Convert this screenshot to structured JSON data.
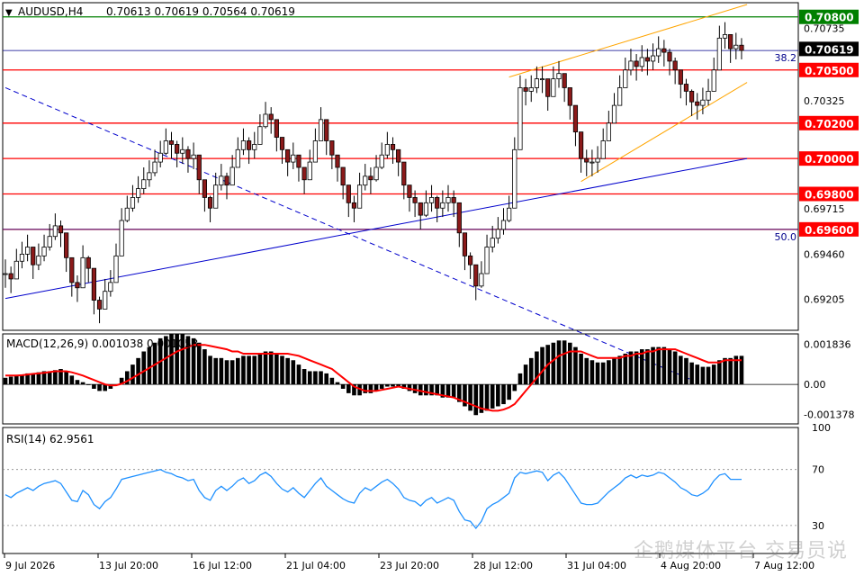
{
  "header": {
    "symbol_tf": "AUDUSD,H4",
    "ohlc": "0.70613 0.70619 0.70564 0.70619"
  },
  "watermark": "企鹅媒体平台 交易员说",
  "colors": {
    "bull": "#ff0000",
    "candle_body_up": "#ffffff",
    "candle_body_down": "#8b1a1a",
    "support": "#ff0000",
    "top_line": "#008000",
    "fib": "#00008b",
    "trend": "#0000cc",
    "channel": "#ffa500",
    "macd_signal": "#ff0000",
    "rsi": "#1e90ff"
  },
  "chart_data": [
    {
      "type": "candlestick",
      "title": "AUDUSD,H4",
      "ylim": [
        0.6903,
        0.7088
      ],
      "y_tick_labels": [
        "0.70735",
        "0.70325",
        "0.69715",
        "0.69460",
        "0.69205"
      ],
      "x_tick_labels": [
        "9 Jul 2026",
        "13 Jul 20:00",
        "16 Jul 12:00",
        "21 Jul 04:00",
        "23 Jul 20:00",
        "28 Jul 12:00",
        "31 Jul 04:00",
        "4 Aug 20:00",
        "7 Aug 12:00"
      ],
      "close": [
        0.6935,
        0.6932,
        0.6942,
        0.6946,
        0.695,
        0.694,
        0.6945,
        0.695,
        0.6956,
        0.6962,
        0.6958,
        0.6944,
        0.693,
        0.6927,
        0.6944,
        0.6938,
        0.692,
        0.6915,
        0.6925,
        0.693,
        0.6945,
        0.6965,
        0.6972,
        0.6978,
        0.6983,
        0.6988,
        0.6992,
        0.6998,
        0.7003,
        0.701,
        0.7008,
        0.7003,
        0.7005,
        0.7,
        0.7002,
        0.6988,
        0.6978,
        0.6972,
        0.6985,
        0.699,
        0.6985,
        0.6995,
        0.7005,
        0.701,
        0.7005,
        0.7008,
        0.7018,
        0.7025,
        0.7022,
        0.7012,
        0.7005,
        0.6998,
        0.7002,
        0.6995,
        0.6988,
        0.6998,
        0.701,
        0.7022,
        0.701,
        0.7002,
        0.6995,
        0.6985,
        0.6975,
        0.6972,
        0.6985,
        0.699,
        0.6988,
        0.6995,
        0.7002,
        0.7008,
        0.7005,
        0.6998,
        0.6985,
        0.6978,
        0.6975,
        0.6968,
        0.6975,
        0.6978,
        0.6972,
        0.6975,
        0.6978,
        0.6975,
        0.6958,
        0.6945,
        0.694,
        0.6928,
        0.6935,
        0.695,
        0.6955,
        0.696,
        0.6965,
        0.6972,
        0.7005,
        0.704,
        0.7038,
        0.704,
        0.7045,
        0.7045,
        0.7035,
        0.7045,
        0.7048,
        0.704,
        0.703,
        0.7015,
        0.7,
        0.6998,
        0.6998,
        0.7,
        0.701,
        0.702,
        0.703,
        0.704,
        0.705,
        0.7055,
        0.7052,
        0.7057,
        0.7055,
        0.7058,
        0.7062,
        0.706,
        0.7055,
        0.705,
        0.7042,
        0.7038,
        0.7032,
        0.703,
        0.7033,
        0.7038,
        0.705,
        0.7068,
        0.707,
        0.7062,
        0.7064,
        0.7061
      ],
      "high": [
        0.6943,
        0.6939,
        0.6949,
        0.6953,
        0.6957,
        0.6947,
        0.6952,
        0.6957,
        0.6963,
        0.6969,
        0.6965,
        0.6951,
        0.6937,
        0.6934,
        0.6951,
        0.6945,
        0.6927,
        0.6922,
        0.6932,
        0.6937,
        0.6952,
        0.6972,
        0.6979,
        0.6985,
        0.699,
        0.6995,
        0.6999,
        0.7005,
        0.701,
        0.7017,
        0.7015,
        0.701,
        0.7012,
        0.7007,
        0.7009,
        0.6995,
        0.6985,
        0.6979,
        0.6992,
        0.6997,
        0.6992,
        0.7002,
        0.7012,
        0.7017,
        0.7012,
        0.7015,
        0.7025,
        0.7032,
        0.7029,
        0.7019,
        0.7012,
        0.7005,
        0.7009,
        0.7002,
        0.6995,
        0.7005,
        0.7017,
        0.7029,
        0.7017,
        0.7009,
        0.7002,
        0.6992,
        0.6982,
        0.6979,
        0.6992,
        0.6997,
        0.6995,
        0.7002,
        0.7009,
        0.7015,
        0.7012,
        0.7005,
        0.6992,
        0.6985,
        0.6982,
        0.6975,
        0.6982,
        0.6985,
        0.6979,
        0.6982,
        0.6985,
        0.6982,
        0.6965,
        0.6952,
        0.6947,
        0.6935,
        0.6942,
        0.6957,
        0.6962,
        0.6967,
        0.6972,
        0.6979,
        0.7012,
        0.7047,
        0.7045,
        0.7047,
        0.7052,
        0.7052,
        0.7042,
        0.7052,
        0.7055,
        0.7047,
        0.7037,
        0.7022,
        0.7007,
        0.7005,
        0.7005,
        0.7007,
        0.7017,
        0.7027,
        0.7037,
        0.7047,
        0.7057,
        0.7062,
        0.7059,
        0.7064,
        0.7062,
        0.7065,
        0.7069,
        0.7067,
        0.7062,
        0.7057,
        0.7049,
        0.7045,
        0.7039,
        0.7037,
        0.704,
        0.7045,
        0.7057,
        0.7075,
        0.7077,
        0.7069,
        0.7071,
        0.7068
      ],
      "low": [
        0.6927,
        0.6924,
        0.6934,
        0.6938,
        0.6942,
        0.6932,
        0.6937,
        0.6942,
        0.6948,
        0.6954,
        0.695,
        0.6936,
        0.6922,
        0.6919,
        0.6936,
        0.693,
        0.6912,
        0.6907,
        0.6917,
        0.6922,
        0.6937,
        0.6957,
        0.6964,
        0.697,
        0.6975,
        0.698,
        0.6984,
        0.699,
        0.6995,
        0.7002,
        0.7,
        0.6995,
        0.6997,
        0.6992,
        0.6994,
        0.698,
        0.697,
        0.6964,
        0.6977,
        0.6982,
        0.6977,
        0.6987,
        0.6997,
        0.7002,
        0.6997,
        0.7,
        0.701,
        0.7017,
        0.7014,
        0.7004,
        0.6997,
        0.699,
        0.6994,
        0.6987,
        0.698,
        0.699,
        0.7002,
        0.7014,
        0.7002,
        0.6994,
        0.6987,
        0.6977,
        0.6967,
        0.6964,
        0.6977,
        0.6982,
        0.698,
        0.6987,
        0.6994,
        0.7,
        0.6997,
        0.699,
        0.6977,
        0.697,
        0.6967,
        0.696,
        0.6967,
        0.697,
        0.6964,
        0.6967,
        0.697,
        0.6967,
        0.695,
        0.6937,
        0.6932,
        0.692,
        0.6927,
        0.6942,
        0.6947,
        0.6952,
        0.6957,
        0.6964,
        0.6997,
        0.7032,
        0.703,
        0.7032,
        0.7037,
        0.7037,
        0.7027,
        0.7037,
        0.704,
        0.7032,
        0.7022,
        0.7007,
        0.6992,
        0.699,
        0.699,
        0.6992,
        0.7002,
        0.7012,
        0.7022,
        0.7032,
        0.7042,
        0.7047,
        0.7044,
        0.7049,
        0.7047,
        0.705,
        0.7054,
        0.7052,
        0.7047,
        0.7042,
        0.7034,
        0.703,
        0.7024,
        0.7022,
        0.7025,
        0.703,
        0.7042,
        0.706,
        0.7062,
        0.7054,
        0.7056,
        0.7056
      ],
      "horizontal_levels": [
        {
          "value": 0.708,
          "label": "0.70800",
          "kind": "resistance"
        },
        {
          "value": 0.705,
          "label": "0.70500",
          "kind": "support"
        },
        {
          "value": 0.702,
          "label": "0.70200",
          "kind": "support"
        },
        {
          "value": 0.7,
          "label": "0.70000",
          "kind": "support"
        },
        {
          "value": 0.698,
          "label": "0.69800",
          "kind": "support"
        },
        {
          "value": 0.696,
          "label": "0.69600",
          "kind": "support"
        }
      ],
      "fib_levels": [
        {
          "value": 0.7061,
          "label": "38.2"
        },
        {
          "value": 0.696,
          "label": "50.0"
        }
      ],
      "current_price": {
        "value": 0.70619,
        "label": "0.70619"
      },
      "trendlines": [
        {
          "kind": "ascending-support",
          "from": {
            "bar": 0,
            "price": 0.6921
          },
          "to": {
            "bar": 134,
            "price": 0.7
          }
        },
        {
          "kind": "descending-dashed",
          "from": {
            "bar": 0,
            "price": 0.704
          },
          "to": {
            "bar": 124,
            "price": 0.6875
          }
        },
        {
          "kind": "channel-upper",
          "from": {
            "bar": 91,
            "price": 0.7046
          },
          "to": {
            "bar": 134,
            "price": 0.7087
          }
        },
        {
          "kind": "channel-lower",
          "from": {
            "bar": 104,
            "price": 0.6987
          },
          "to": {
            "bar": 134,
            "price": 0.7043
          }
        }
      ]
    },
    {
      "type": "bar",
      "title": "MACD(12,26,9) 0.001038 0.001058",
      "ylim": [
        -0.0018,
        0.0023
      ],
      "y_tick_labels": [
        "0.001836",
        "0.00",
        "-0.001378"
      ],
      "values": [
        0.0003,
        0.00035,
        0.0004,
        0.00045,
        0.0005,
        0.0005,
        0.00055,
        0.0006,
        0.0006,
        0.00065,
        0.0007,
        0.0006,
        0.0004,
        0.0002,
        0.0001,
        0.0,
        -0.0002,
        -0.0003,
        -0.0003,
        -0.0002,
        0.0,
        0.0003,
        0.0006,
        0.0009,
        0.0012,
        0.0015,
        0.0017,
        0.0019,
        0.0021,
        0.0022,
        0.0023,
        0.0023,
        0.0023,
        0.0022,
        0.0021,
        0.0019,
        0.0016,
        0.0013,
        0.0012,
        0.0012,
        0.0011,
        0.0011,
        0.0012,
        0.0013,
        0.0013,
        0.0013,
        0.0014,
        0.0015,
        0.0015,
        0.0014,
        0.0013,
        0.0012,
        0.0011,
        0.0009,
        0.0007,
        0.0006,
        0.0006,
        0.0006,
        0.0005,
        0.0003,
        0.0001,
        -0.0002,
        -0.0004,
        -0.0005,
        -0.0005,
        -0.0004,
        -0.0004,
        -0.0003,
        -0.0002,
        -0.0001,
        -0.0001,
        -0.0001,
        -0.0002,
        -0.0003,
        -0.0004,
        -0.0005,
        -0.0005,
        -0.0005,
        -0.0005,
        -0.0006,
        -0.0006,
        -0.0006,
        -0.0008,
        -0.001,
        -0.0012,
        -0.0014,
        -0.0013,
        -0.0012,
        -0.0011,
        -0.001,
        -0.0009,
        -0.0007,
        -0.0003,
        0.0005,
        0.0009,
        0.0012,
        0.0015,
        0.0017,
        0.0018,
        0.0019,
        0.002,
        0.002,
        0.0019,
        0.0017,
        0.0014,
        0.0012,
        0.0011,
        0.001,
        0.001,
        0.0011,
        0.0012,
        0.0013,
        0.0014,
        0.0015,
        0.0015,
        0.0016,
        0.0016,
        0.0017,
        0.0017,
        0.0017,
        0.0016,
        0.0015,
        0.0013,
        0.0012,
        0.001,
        0.0009,
        0.0008,
        0.0008,
        0.0009,
        0.0011,
        0.0012,
        0.0012,
        0.0013,
        0.0013
      ],
      "signal": [
        0.0004,
        0.0004,
        0.0004,
        0.00042,
        0.00045,
        0.00048,
        0.0005,
        0.00053,
        0.00056,
        0.0006,
        0.0006,
        0.0006,
        0.00055,
        0.00048,
        0.0004,
        0.0003,
        0.0002,
        0.0001,
        0.0,
        -5e-05,
        -4e-05,
        3e-05,
        0.00015,
        0.0003,
        0.00045,
        0.0006,
        0.00075,
        0.0009,
        0.00105,
        0.0012,
        0.00135,
        0.0015,
        0.0016,
        0.0017,
        0.0018,
        0.0018,
        0.0018,
        0.00175,
        0.0017,
        0.00165,
        0.0016,
        0.0015,
        0.0015,
        0.0014,
        0.0014,
        0.0014,
        0.0014,
        0.0014,
        0.0014,
        0.0014,
        0.0014,
        0.0014,
        0.00135,
        0.0013,
        0.0012,
        0.0011,
        0.001,
        0.0009,
        0.0008,
        0.0007,
        0.0005,
        0.0003,
        0.0001,
        -0.0001,
        -0.0002,
        -0.0003,
        -0.0003,
        -0.0003,
        -0.00025,
        -0.0002,
        -0.00015,
        -0.0001,
        -0.00015,
        -0.0002,
        -0.00025,
        -0.0003,
        -0.00035,
        -0.0004,
        -0.00045,
        -0.0005,
        -0.00055,
        -0.0006,
        -0.0007,
        -0.0008,
        -0.0009,
        -0.001,
        -0.0011,
        -0.00115,
        -0.0012,
        -0.0012,
        -0.00115,
        -0.00105,
        -0.0009,
        -0.0006,
        -0.0003,
        0.0,
        0.0003,
        0.0006,
        0.0009,
        0.0011,
        0.0013,
        0.0014,
        0.0015,
        0.0015,
        0.0015,
        0.0014,
        0.0013,
        0.0012,
        0.0012,
        0.0012,
        0.0012,
        0.0012,
        0.0013,
        0.0013,
        0.0014,
        0.0014,
        0.0015,
        0.0015,
        0.0016,
        0.0016,
        0.0016,
        0.0016,
        0.0015,
        0.0014,
        0.0013,
        0.0012,
        0.0011,
        0.001,
        0.001,
        0.001,
        0.0011,
        0.0011,
        0.0011,
        0.0011
      ]
    },
    {
      "type": "line",
      "title": "RSI(14) 62.9561",
      "ylim": [
        10,
        100
      ],
      "y_tick_labels": [
        "100",
        "70",
        "30"
      ],
      "levels": [
        70,
        30
      ],
      "values": [
        52,
        50,
        53,
        55,
        57,
        55,
        58,
        60,
        61,
        62,
        60,
        54,
        48,
        47,
        55,
        52,
        45,
        42,
        47,
        50,
        56,
        63,
        64,
        65,
        66,
        67,
        68,
        69,
        70,
        68,
        67,
        65,
        64,
        62,
        63,
        55,
        50,
        48,
        55,
        58,
        55,
        58,
        62,
        64,
        60,
        62,
        66,
        68,
        65,
        60,
        56,
        54,
        57,
        53,
        50,
        55,
        60,
        64,
        58,
        55,
        52,
        49,
        47,
        46,
        53,
        57,
        55,
        58,
        61,
        63,
        60,
        56,
        50,
        48,
        47,
        44,
        48,
        50,
        46,
        48,
        50,
        48,
        40,
        34,
        33,
        28,
        33,
        42,
        45,
        47,
        50,
        53,
        64,
        68,
        67,
        68,
        69,
        68,
        62,
        66,
        68,
        64,
        58,
        52,
        46,
        45,
        45,
        46,
        50,
        54,
        57,
        60,
        64,
        66,
        64,
        66,
        65,
        66,
        68,
        67,
        64,
        61,
        57,
        55,
        52,
        51,
        53,
        56,
        62,
        66,
        67,
        63,
        63,
        63
      ]
    }
  ]
}
